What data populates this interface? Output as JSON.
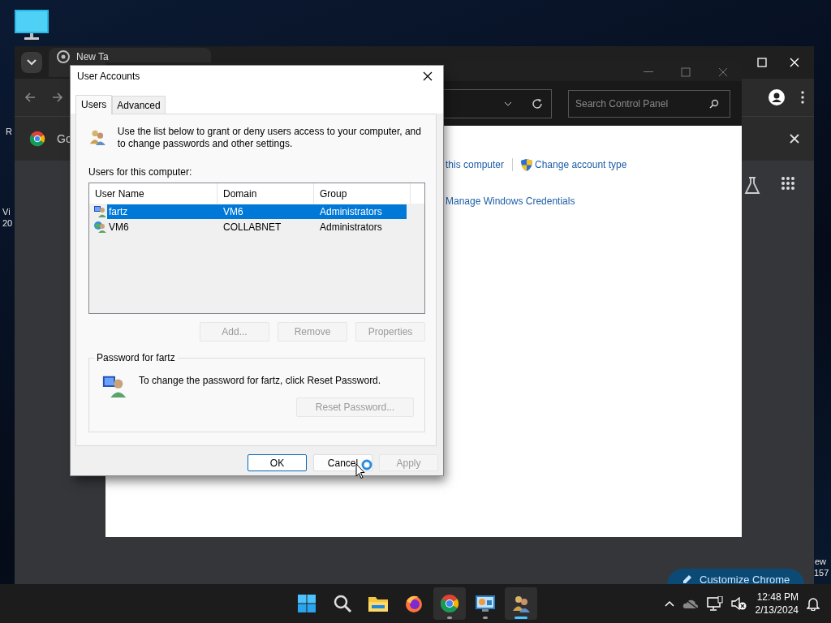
{
  "desktop": {
    "left_labels": [
      "R",
      "Vi",
      "20"
    ],
    "right_labels": [
      "ew",
      "157"
    ]
  },
  "browser": {
    "tab": {
      "title": "New Ta"
    },
    "shortcut": {
      "label": "Go"
    },
    "customize_button": {
      "label": "Customize Chrome"
    }
  },
  "control_panel": {
    "search": {
      "placeholder": "Search Control Panel"
    },
    "links": [
      {
        "label": "this computer",
        "kind": "plain"
      },
      {
        "label": "Change account type",
        "kind": "shield"
      },
      {
        "label": "Manage Windows Credentials",
        "kind": "plain"
      }
    ]
  },
  "dialog": {
    "title": "User Accounts",
    "tabs": [
      {
        "label": "Users",
        "selected": true
      },
      {
        "label": "Advanced",
        "selected": false
      }
    ],
    "intro": "Use the list below to grant or deny users access to your computer, and to change passwords and other settings.",
    "list_label": "Users for this computer:",
    "columns": [
      "User Name",
      "Domain",
      "Group"
    ],
    "rows": [
      {
        "kind": "local",
        "cells": [
          "fartz",
          "VM6",
          "Administrators"
        ],
        "selected": true
      },
      {
        "kind": "domain",
        "cells": [
          "VM6",
          "COLLABNET",
          "Administrators"
        ],
        "selected": false
      }
    ],
    "list_buttons": [
      {
        "label": "Add...",
        "disabled": true
      },
      {
        "label": "Remove",
        "disabled": true
      },
      {
        "label": "Properties",
        "disabled": true
      }
    ],
    "password_group": {
      "title": "Password for fartz",
      "text": "To change the password for fartz, click Reset Password.",
      "button": {
        "label": "Reset Password...",
        "disabled": true
      }
    },
    "footer_buttons": [
      {
        "label": "OK",
        "default": true,
        "disabled": false
      },
      {
        "label": "Cancel",
        "default": false,
        "disabled": false
      },
      {
        "label": "Apply",
        "default": false,
        "disabled": true
      }
    ]
  },
  "taskbar": {
    "apps": [
      {
        "kind": "start",
        "highlighted": false,
        "running": false,
        "focused": false
      },
      {
        "kind": "search",
        "highlighted": false,
        "running": false,
        "focused": false
      },
      {
        "kind": "explorer",
        "highlighted": false,
        "running": false,
        "focused": false
      },
      {
        "kind": "firefox",
        "highlighted": false,
        "running": false,
        "focused": false
      },
      {
        "kind": "chrome",
        "highlighted": true,
        "running": true,
        "focused": false
      },
      {
        "kind": "control_panel",
        "highlighted": false,
        "running": true,
        "focused": false
      },
      {
        "kind": "users",
        "highlighted": true,
        "running": true,
        "focused": true
      }
    ],
    "time": "12:48 PM",
    "date": "2/13/2024"
  }
}
